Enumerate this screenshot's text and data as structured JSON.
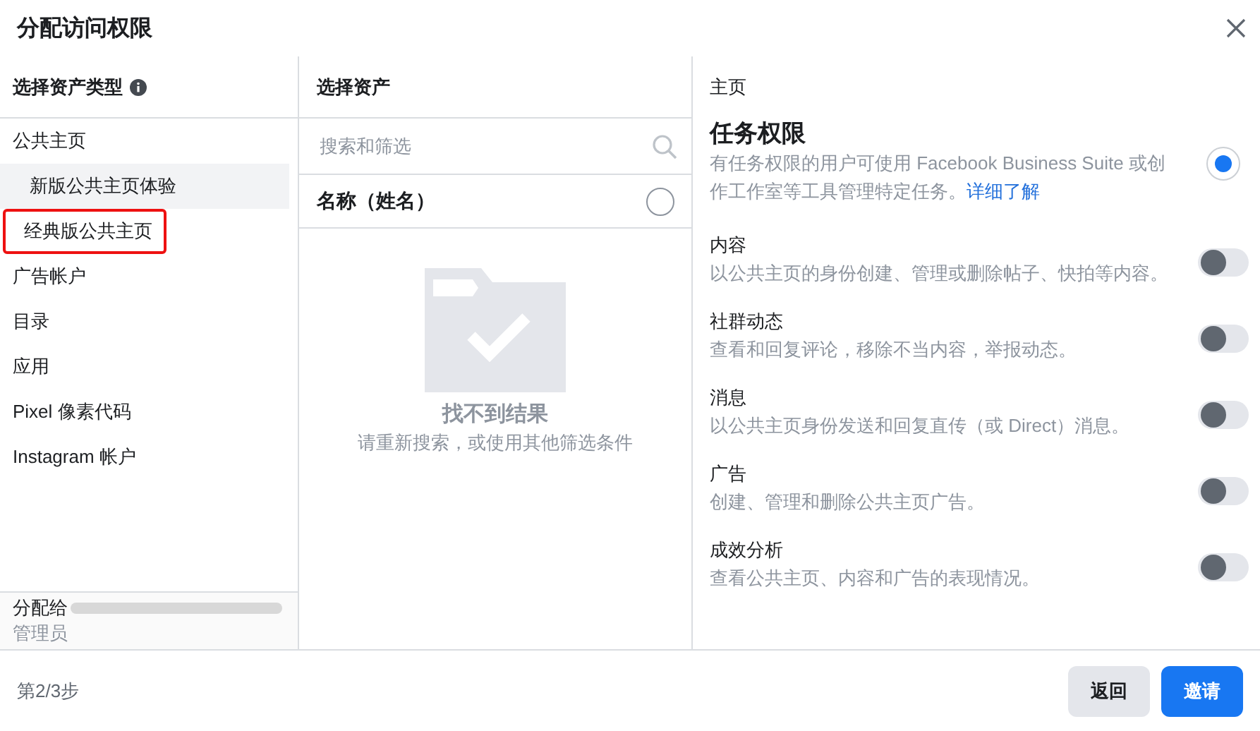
{
  "dialog": {
    "title": "分配访问权限"
  },
  "asset_types": {
    "heading": "选择资产类型",
    "items": [
      {
        "label": "公共主页",
        "selected": false,
        "children": [
          {
            "label": "新版公共主页体验",
            "selected": true,
            "highlighted": false
          },
          {
            "label": "经典版公共主页",
            "selected": false,
            "highlighted": true
          }
        ]
      },
      {
        "label": "广告帐户",
        "selected": false
      },
      {
        "label": "目录",
        "selected": false
      },
      {
        "label": "应用",
        "selected": false
      },
      {
        "label": "Pixel 像素代码",
        "selected": false
      },
      {
        "label": "Instagram 帐户",
        "selected": false
      }
    ]
  },
  "assign": {
    "label": "分配给",
    "role": "管理员"
  },
  "assets": {
    "heading": "选择资产",
    "search": {
      "placeholder": "搜索和筛选"
    },
    "header": {
      "label": "名称（姓名）",
      "checked": false
    },
    "empty": {
      "title": "找不到结果",
      "hint": "请重新搜索，或使用其他筛选条件"
    }
  },
  "permissions": {
    "heading": "主页",
    "items": [
      {
        "kind": "radio",
        "title": "任务权限",
        "description": "有任务权限的用户可使用 Facebook Business Suite 或创作工作室等工具管理特定任务。",
        "link": "详细了解",
        "on": true
      },
      {
        "kind": "toggle",
        "title": "内容",
        "description": "以公共主页的身份创建、管理或删除帖子、快拍等内容。",
        "on": false
      },
      {
        "kind": "toggle",
        "title": "社群动态",
        "description": "查看和回复评论，移除不当内容，举报动态。",
        "on": false
      },
      {
        "kind": "toggle",
        "title": "消息",
        "description": "以公共主页身份发送和回复直传（或 Direct）消息。",
        "on": false
      },
      {
        "kind": "toggle",
        "title": "广告",
        "description": "创建、管理和删除公共主页广告。",
        "on": false
      },
      {
        "kind": "toggle",
        "title": "成效分析",
        "description": "查看公共主页、内容和广告的表现情况。",
        "on": false
      }
    ]
  },
  "footer": {
    "step": "第2/3步",
    "buttons": [
      {
        "label": "返回",
        "primary": false
      },
      {
        "label": "邀请",
        "primary": true
      }
    ]
  }
}
